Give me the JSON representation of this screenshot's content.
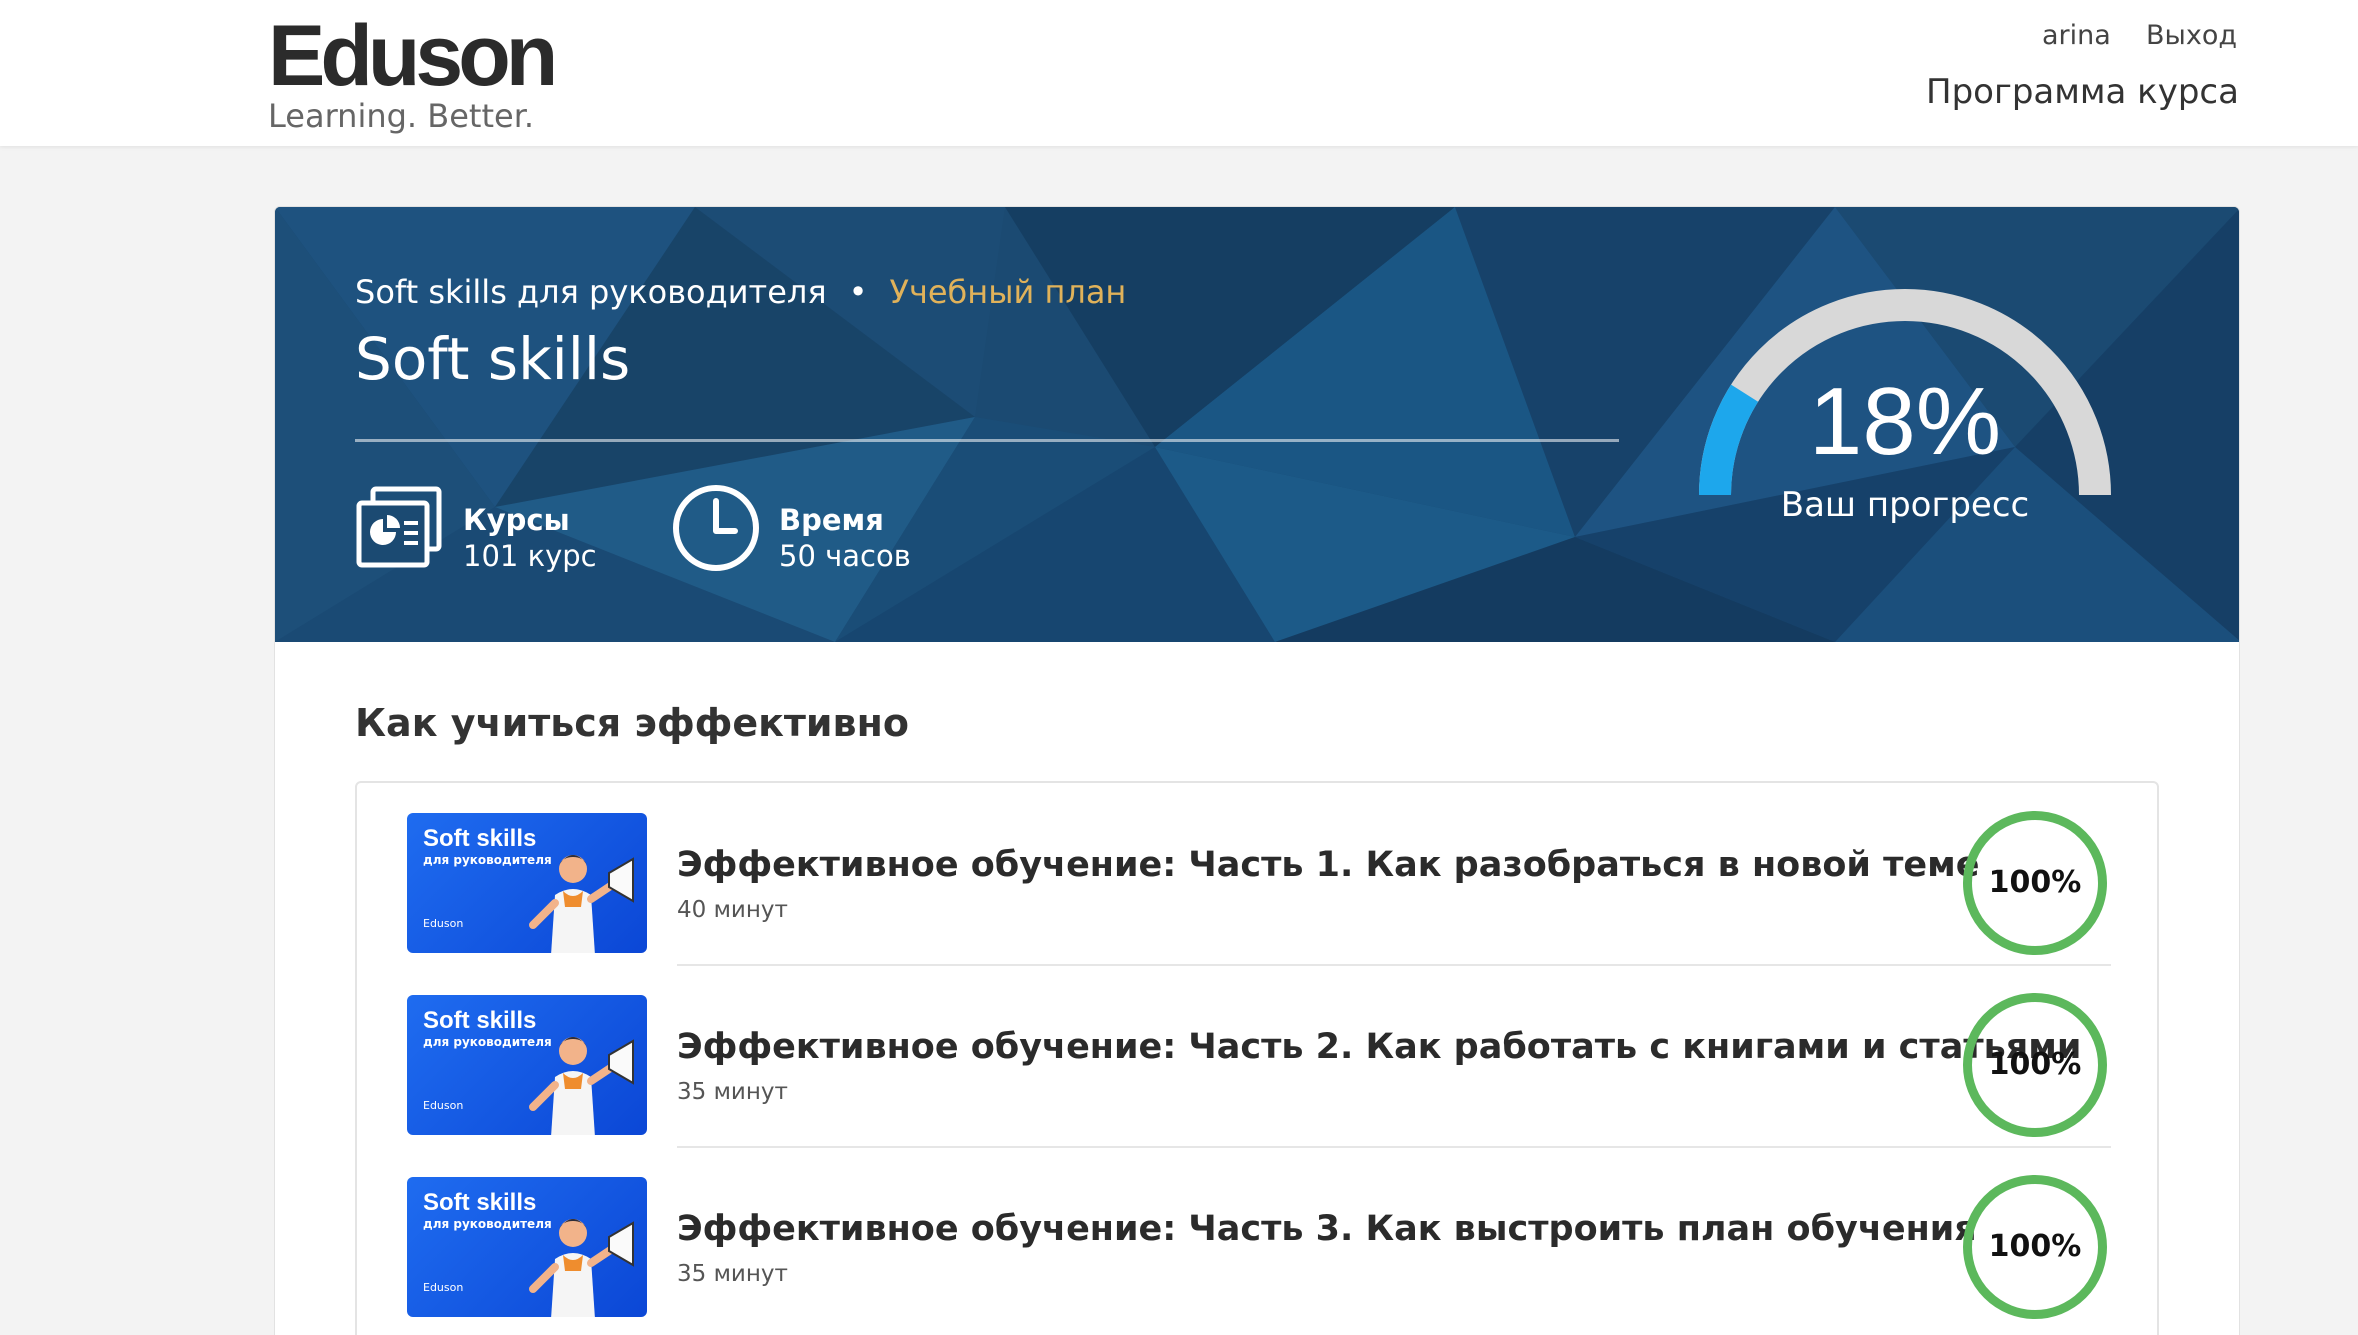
{
  "header": {
    "logo_main": "Eduson",
    "logo_sub": "Learning. Better.",
    "user_name": "arina",
    "logout_label": "Выход",
    "program_label": "Программа курса"
  },
  "hero": {
    "breadcrumb_course": "Soft skills для руководителя",
    "breadcrumb_separator": "•",
    "breadcrumb_plan": "Учебный план",
    "title": "Soft skills",
    "stats": {
      "courses_label": "Курсы",
      "courses_value": "101 курс",
      "time_label": "Время",
      "time_value": "50 часов"
    },
    "progress_percent": 18,
    "progress_text": "18%",
    "progress_label": "Ваш прогресс"
  },
  "section": {
    "title": "Как учиться эффективно",
    "lessons": [
      {
        "thumb_title": "Soft skills",
        "thumb_subtitle": "для руководителя",
        "thumb_logo": "Eduson",
        "title": "Эффективное обучение: Часть 1. Как разобраться в новой теме",
        "duration": "40 минут",
        "progress": "100%"
      },
      {
        "thumb_title": "Soft skills",
        "thumb_subtitle": "для руководителя",
        "thumb_logo": "Eduson",
        "title": "Эффективное обучение: Часть 2. Как работать с книгами и статьями",
        "duration": "35 минут",
        "progress": "100%"
      },
      {
        "thumb_title": "Soft skills",
        "thumb_subtitle": "для руководителя",
        "thumb_logo": "Eduson",
        "title": "Эффективное обучение: Часть 3. Как выстроить план обучения",
        "duration": "35 минут",
        "progress": "100%"
      }
    ]
  },
  "colors": {
    "hero_bg": "#1b4a72",
    "accent_plan": "#e0b25a",
    "progress_fill": "#1da7ec",
    "progress_track": "#d8d8d8",
    "ring_complete": "#5cb85c"
  }
}
